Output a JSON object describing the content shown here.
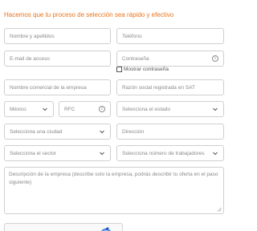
{
  "heading": "Hacemos que tu proceso de selección sea rápido y efectivo",
  "form": {
    "name_placeholder": "Nombre y apellidos",
    "phone_placeholder": "Teléfono",
    "email_placeholder": "E-mail de acceso",
    "password_placeholder": "Contraseña",
    "show_password_label": "Mostrar contraseña",
    "company_name_placeholder": "Nombre comercial de la empresa",
    "legal_name_placeholder": "Razón social registrada en SAT",
    "country_value": "México",
    "rfc_placeholder": "RFC",
    "state_value": "Selecciona el estado",
    "city_value": "Selecciona una ciudad",
    "address_placeholder": "Dirección",
    "sector_value": "Selecciona el sector",
    "employees_value": "Selecciona número de trabajadores",
    "description_placeholder": "Descripción de la empresa (describe solo la empresa, podrás describir tu oferta en el paso siguiente)"
  },
  "icons": {
    "info": "info-circle-icon",
    "chevron": "chevron-down-icon",
    "captcha": "recaptcha-logo-icon",
    "resize": "resize-grip-icon"
  },
  "colors": {
    "heading": "#e8741c",
    "border": "#cfcfcf",
    "placeholder": "#8a8a8a"
  }
}
